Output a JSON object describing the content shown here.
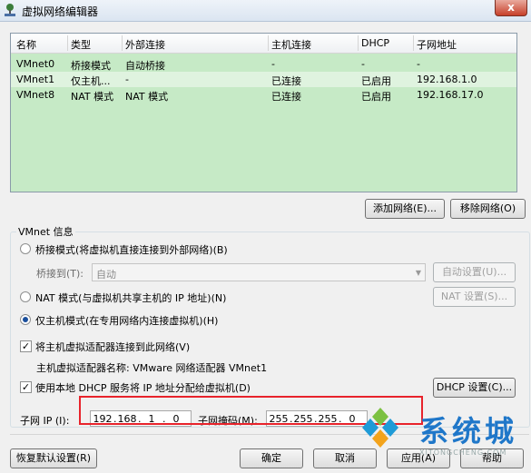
{
  "window": {
    "title": "虚拟网络编辑器",
    "close_label": "x"
  },
  "table": {
    "columns": [
      "名称",
      "类型",
      "外部连接",
      "主机连接",
      "DHCP",
      "子网地址"
    ],
    "rows": [
      [
        "VMnet0",
        "桥接模式",
        "自动桥接",
        "-",
        "-",
        "-"
      ],
      [
        "VMnet1",
        "仅主机...",
        "-",
        "已连接",
        "已启用",
        "192.168.1.0"
      ],
      [
        "VMnet8",
        "NAT 模式",
        "NAT 模式",
        "已连接",
        "已启用",
        "192.168.17.0"
      ]
    ],
    "selected_row": 1
  },
  "buttons": {
    "add_network": "添加网络(E)...",
    "remove_network": "移除网络(O)"
  },
  "vmnet_info": {
    "group_title": "VMnet 信息",
    "bridged_label": "桥接模式(将虚拟机直接连接到外部网络)(B)",
    "bridge_to_label": "桥接到(T):",
    "bridge_to_value": "自动",
    "auto_settings": "自动设置(U)...",
    "nat_label": "NAT 模式(与虚拟机共享主机的 IP 地址)(N)",
    "nat_settings": "NAT 设置(S)...",
    "hostonly_label": "仅主机模式(在专用网络内连接虚拟机)(H)",
    "selected_mode": "host-only",
    "connect_adapter_label": "将主机虚拟适配器连接到此网络(V)",
    "connect_adapter_checked": true,
    "adapter_name_label": "主机虚拟适配器名称: VMware 网络适配器 VMnet1",
    "dhcp_label": "使用本地 DHCP 服务将 IP 地址分配给虚拟机(D)",
    "dhcp_checked": true,
    "dhcp_settings": "DHCP 设置(C)...",
    "subnet_ip_label": "子网 IP (I):",
    "subnet_ip": [
      "192",
      "168",
      "1",
      "0"
    ],
    "subnet_mask_label": "子网掩码(M):",
    "subnet_mask": [
      "255",
      "255",
      "255",
      "0"
    ]
  },
  "footer": {
    "restore_defaults": "恢复默认设置(R)",
    "ok": "确定",
    "cancel": "取消",
    "apply": "应用(A)",
    "help": "帮助"
  },
  "watermark": {
    "text": "系统城",
    "url": "XITONGCHENG.COM"
  },
  "colors": {
    "table_bg": "#c6eac6",
    "highlight": "#e8232b",
    "watermark": "#1f77c9"
  }
}
